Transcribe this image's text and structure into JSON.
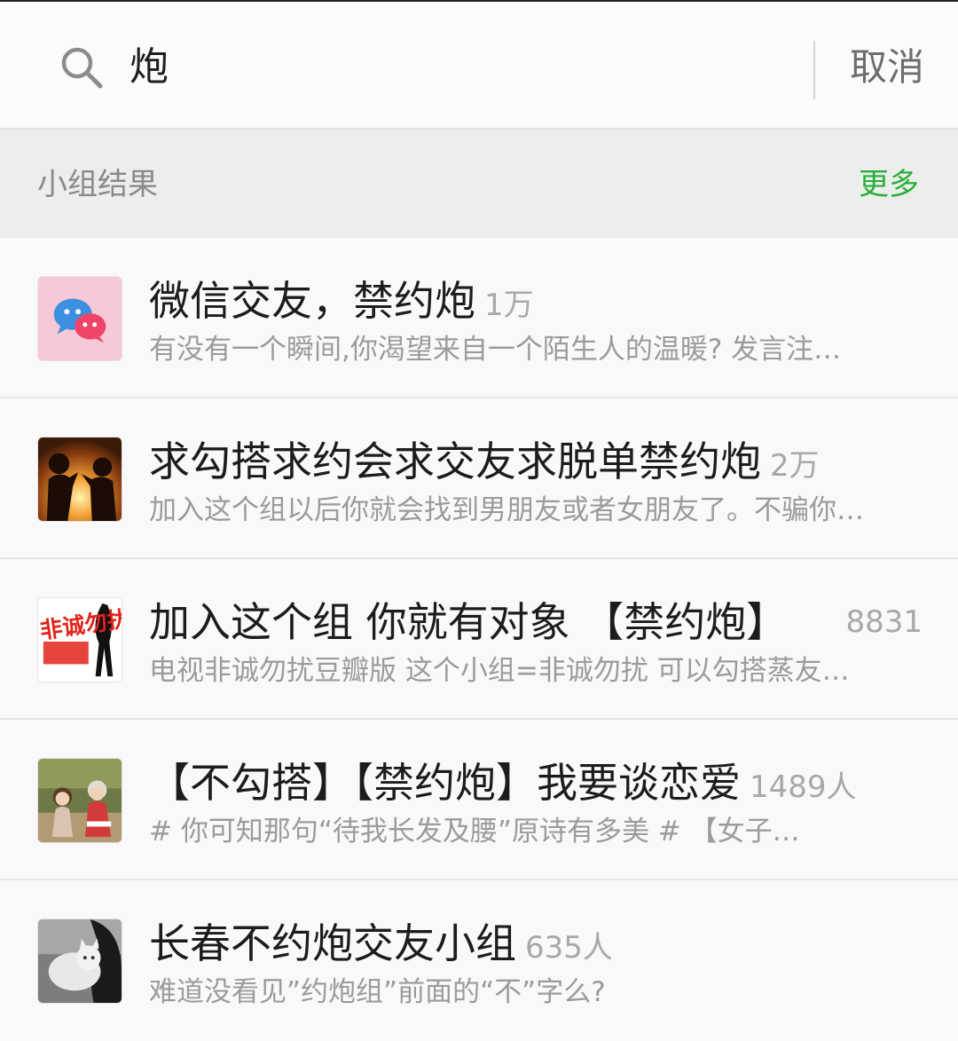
{
  "search": {
    "value": "炮",
    "cancel_label": "取消"
  },
  "section": {
    "title": "小组结果",
    "more_label": "更多"
  },
  "colors": {
    "accent_green": "#2aae3b",
    "text_primary": "#1c1c1c",
    "text_secondary": "#9b9b9b"
  },
  "results": [
    {
      "title": "微信交友，禁约炮",
      "count": "1万",
      "description": "有没有一个瞬间,你渴望来自一个陌生人的温暖?   发言注…",
      "avatar_icon": "wechat-logo-icon"
    },
    {
      "title": "求勾搭求约会求交友求脱单禁约炮",
      "count": "2万",
      "description": "加入这个组以后你就会找到男朋友或者女朋友了。不骗你…",
      "avatar_icon": "couple-silhouette-image"
    },
    {
      "title": "加入这个组 你就有对象 【禁约炮】",
      "count": "8831",
      "description": "电视非诚勿扰豆瓣版  这个小组=非诚勿扰  可以勾搭蒸友…",
      "avatar_icon": "feichengwurao-logo-image",
      "logo_text": "非诚勿扰"
    },
    {
      "title": "【不勾搭】【禁约炮】我要谈恋爱",
      "count": "1489人",
      "description": "#  你可知那句“待我长发及腰”原诗有多美 #   【女子…",
      "avatar_icon": "two-girls-photo-image"
    },
    {
      "title": "长春不约炮交友小组",
      "count": "635人",
      "description": "难道没看见”约炮组”前面的“不”字么?",
      "avatar_icon": "girl-with-cat-photo-image"
    }
  ]
}
